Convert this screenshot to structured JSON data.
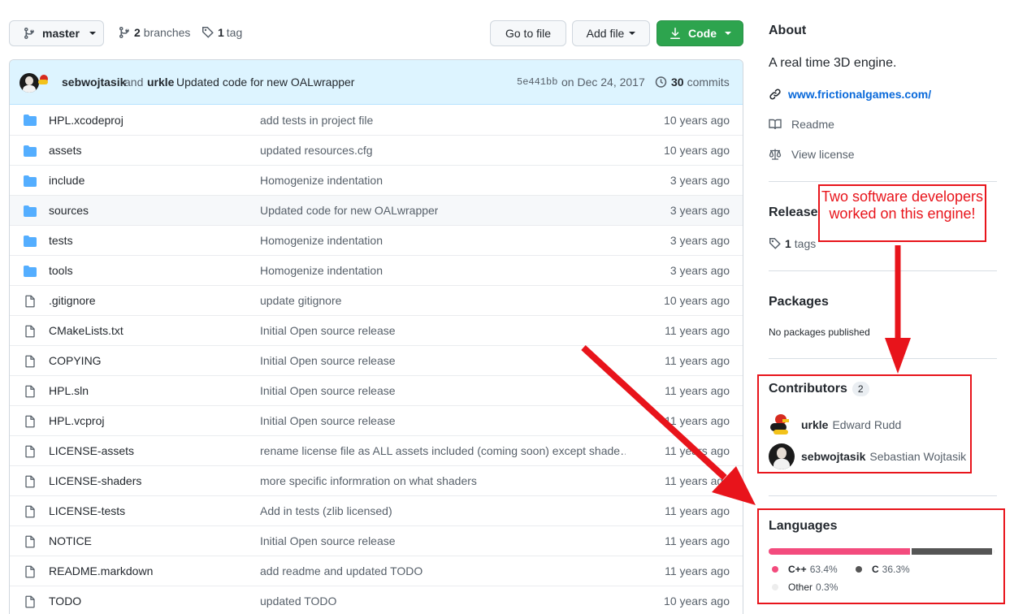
{
  "branch": {
    "name": "master",
    "branches_count": "2",
    "branches_label": "branches",
    "tags_count": "1",
    "tags_label": "tag"
  },
  "toolbar": {
    "go_to_file": "Go to file",
    "add_file": "Add file",
    "code": "Code"
  },
  "commit": {
    "author1": "sebwojtasik",
    "and": "and",
    "author2": "urkle",
    "message": "Updated code for new OALwrapper",
    "sha": "5e441bb",
    "date": "on Dec 24, 2017",
    "count": "30",
    "count_label": "commits"
  },
  "files": [
    {
      "name": "HPL.xcodeproj",
      "type": "folder",
      "message": "add tests in project file",
      "age": "10 years ago"
    },
    {
      "name": "assets",
      "type": "folder",
      "message": "updated resources.cfg",
      "age": "10 years ago"
    },
    {
      "name": "include",
      "type": "folder",
      "message": "Homogenize indentation",
      "age": "3 years ago"
    },
    {
      "name": "sources",
      "type": "folder",
      "message": "Updated code for new OALwrapper",
      "age": "3 years ago"
    },
    {
      "name": "tests",
      "type": "folder",
      "message": "Homogenize indentation",
      "age": "3 years ago"
    },
    {
      "name": "tools",
      "type": "folder",
      "message": "Homogenize indentation",
      "age": "3 years ago"
    },
    {
      "name": ".gitignore",
      "type": "file",
      "message": "update gitignore",
      "age": "10 years ago"
    },
    {
      "name": "CMakeLists.txt",
      "type": "file",
      "message": "Initial Open source release",
      "age": "11 years ago"
    },
    {
      "name": "COPYING",
      "type": "file",
      "message": "Initial Open source release",
      "age": "11 years ago"
    },
    {
      "name": "HPL.sln",
      "type": "file",
      "message": "Initial Open source release",
      "age": "11 years ago"
    },
    {
      "name": "HPL.vcproj",
      "type": "file",
      "message": "Initial Open source release",
      "age": "11 years ago"
    },
    {
      "name": "LICENSE-assets",
      "type": "file",
      "message": "rename license file as ALL assets included (coming soon) except shade…",
      "age": "11 years ago"
    },
    {
      "name": "LICENSE-shaders",
      "type": "file",
      "message": "more specific informration on what shaders",
      "age": "11 years ago"
    },
    {
      "name": "LICENSE-tests",
      "type": "file",
      "message": "Add in tests (zlib licensed)",
      "age": "11 years ago"
    },
    {
      "name": "NOTICE",
      "type": "file",
      "message": "Initial Open source release",
      "age": "11 years ago"
    },
    {
      "name": "README.markdown",
      "type": "file",
      "message": "add readme and updated TODO",
      "age": "11 years ago"
    },
    {
      "name": "TODO",
      "type": "file",
      "message": "updated TODO",
      "age": "10 years ago"
    }
  ],
  "about": {
    "heading": "About",
    "description": "A real time 3D engine.",
    "website": "www.frictionalgames.com/",
    "readme": "Readme",
    "license": "View license"
  },
  "releases": {
    "heading": "Releases",
    "tags_count": "1",
    "tags_label": "tags"
  },
  "packages": {
    "heading": "Packages",
    "text": "No packages published"
  },
  "contributors": {
    "heading": "Contributors",
    "count": "2",
    "people": [
      {
        "login": "urkle",
        "name": "Edward Rudd"
      },
      {
        "login": "sebwojtasik",
        "name": "Sebastian Wojtasik"
      }
    ]
  },
  "languages": {
    "heading": "Languages",
    "items": [
      {
        "name": "C++",
        "percent": "63.4%",
        "value": 63.4,
        "color": "#f34b7d"
      },
      {
        "name": "C",
        "percent": "36.3%",
        "value": 36.3,
        "color": "#555555"
      },
      {
        "name": "Other",
        "percent": "0.3%",
        "value": 0.3,
        "color": "#ededed"
      }
    ]
  },
  "annotation": {
    "callout": "Two software developers worked on this engine!"
  },
  "colors": {
    "primary_button": "#2da44e",
    "link": "#0969da",
    "annotation_red": "#e8141b",
    "folder": "#54aeff"
  }
}
